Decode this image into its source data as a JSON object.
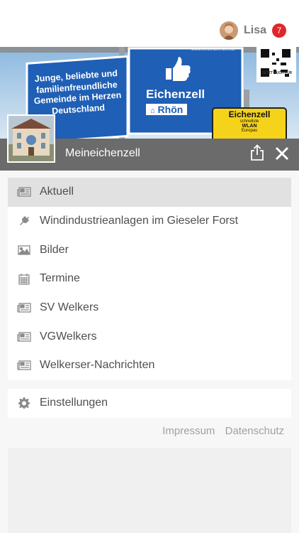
{
  "header": {
    "user_name": "Lisa",
    "notification_count": "7"
  },
  "banner": {
    "sign_left_text": "Junge, beliebte und familienfreundliche Gemeinde im Herzen Deutschland",
    "sign_center_title": "Eichenzell",
    "sign_center_sub": "Rhön",
    "sign_right_title": "Eichenzell",
    "sign_right_sub1": "schnellste",
    "sign_right_sub2": "WLAN",
    "sign_right_sub3": "Europas",
    "qr_caption": "JETZT AUCH FÜR",
    "site_url": "www.meineichenzell.de"
  },
  "app": {
    "title": "Meineichenzell"
  },
  "menu": {
    "items": [
      {
        "label": "Aktuell",
        "icon": "newspaper-icon",
        "active": true
      },
      {
        "label": "Windindustrieanlagen im Gieseler Forst",
        "icon": "plug-icon"
      },
      {
        "label": "Bilder",
        "icon": "image-icon"
      },
      {
        "label": "Termine",
        "icon": "calendar-icon"
      },
      {
        "label": "SV Welkers",
        "icon": "newspaper-icon"
      },
      {
        "label": "VGWelkers",
        "icon": "newspaper-icon"
      },
      {
        "label": "Welkerser-Nachrichten",
        "icon": "newspaper-icon"
      }
    ],
    "settings_label": "Einstellungen"
  },
  "footer": {
    "impressum": "Impressum",
    "datenschutz": "Datenschutz"
  },
  "colors": {
    "badge": "#e0262a",
    "titlebar": "#6b6b6b",
    "active_row": "#e1e1e1",
    "sign_blue": "#1f5fb5",
    "sign_yellow": "#f5d31a"
  }
}
